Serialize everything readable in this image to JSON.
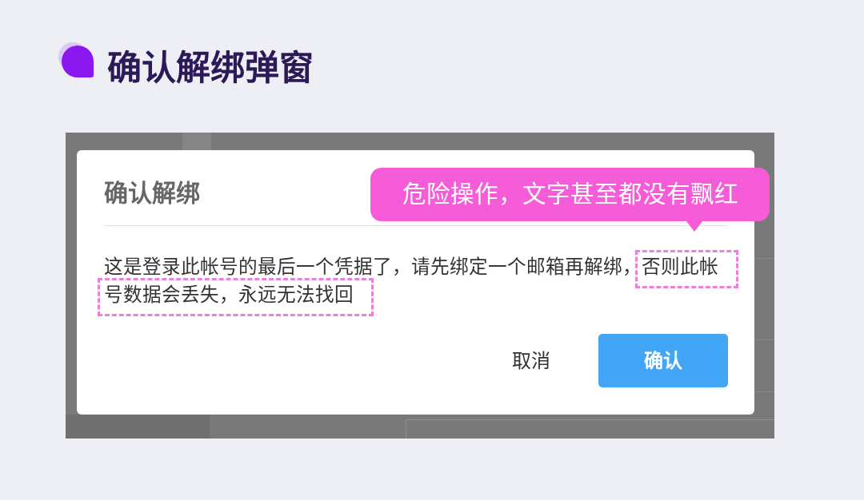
{
  "page_title": "确认解绑弹窗",
  "dialog": {
    "title": "确认解绑",
    "message": [
      {
        "text": "这是登录此帐号的最后一个凭据了，请先绑定一个邮箱再解绑，",
        "highlighted": false
      },
      {
        "text": "否则此帐号数据会丢失，永远无法找回",
        "highlighted": true
      }
    ],
    "buttons": [
      {
        "label": "取消",
        "kind": "text"
      },
      {
        "label": "确认",
        "kind": "primary"
      }
    ]
  },
  "annotation": {
    "text": "危险操作，文字甚至都没有飘红"
  }
}
